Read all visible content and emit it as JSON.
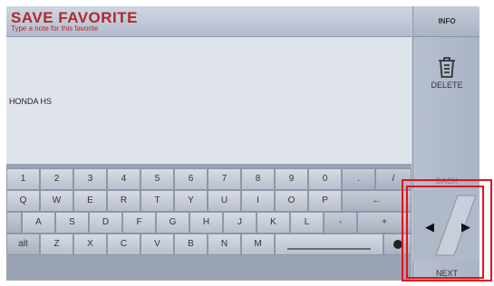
{
  "header": {
    "title": "SAVE FAVORITE",
    "subtitle": "Type a note for this favorite"
  },
  "note": {
    "value": "HONDA HS"
  },
  "panel": {
    "info_label": "INFO",
    "delete_label": "DELETE",
    "back_label": "BACK",
    "next_label": "NEXT",
    "left_arrow": "◀",
    "right_arrow": "▶"
  },
  "keyboard": {
    "row1": [
      "1",
      "2",
      "3",
      "4",
      "5",
      "6",
      "7",
      "8",
      "9",
      "0",
      ".",
      "/"
    ],
    "row2": [
      "Q",
      "W",
      "E",
      "R",
      "T",
      "Y",
      "U",
      "I",
      "O",
      "P",
      "←"
    ],
    "row3": [
      "A",
      "S",
      "D",
      "F",
      "G",
      "H",
      "J",
      "K",
      "L",
      "-",
      "+"
    ],
    "row4": [
      "alt",
      "Z",
      "X",
      "C",
      "V",
      "B",
      "N",
      "M",
      " ",
      ""
    ]
  },
  "colors": {
    "title_red": "#b0282a",
    "highlight": "#e0141b"
  }
}
